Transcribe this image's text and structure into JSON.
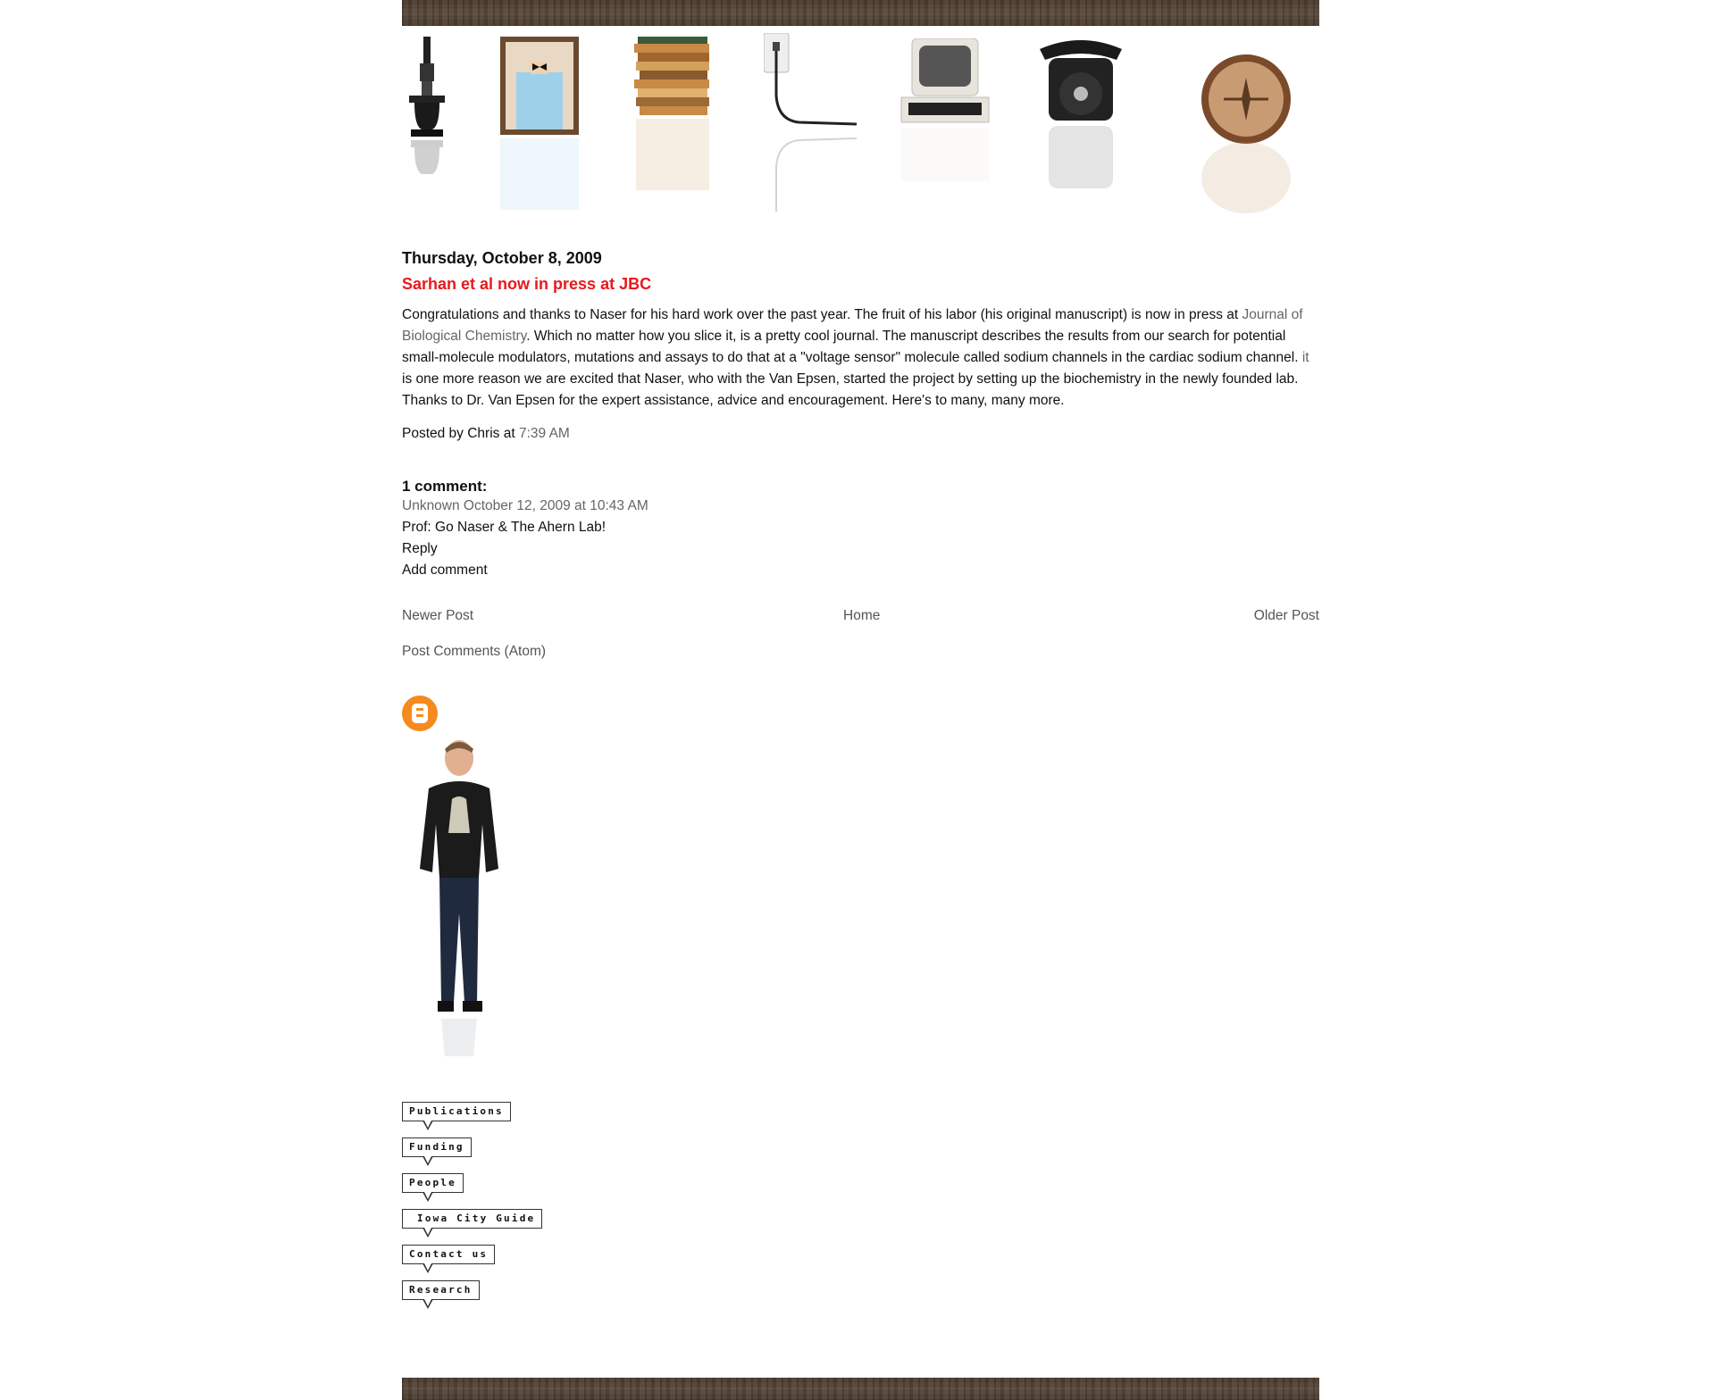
{
  "post": {
    "date": "Thursday, October 8, 2009",
    "title": "Sarhan et al now in press at JBC",
    "body_part1": "Congratulations and thanks to Naser for his hard work over the past year. The fruit of his labor (his original manuscript) is now in press at ",
    "journal_link": "Journal of Biological Chemistry",
    "body_part2": ". Which no matter how you slice it, is a pretty cool journal. The manuscript describes the results from our search for potential small-molecule modulators, mutations and assays to do that at a \"voltage sensor\" molecule called sodium channels in the cardiac sodium channel. ",
    "it_link": "it",
    "body_part3": " is one more reason we are excited that Naser, who with the Van Epsen, started the project by setting up the biochemistry in the newly founded lab. Thanks to Dr. Van Epsen for the expert assistance, advice and encouragement. Here's to many, many more.",
    "byline_prefix": "Posted by Chris at ",
    "time": "7:39 AM"
  },
  "comments": {
    "heading": "1 comment:",
    "items": [
      {
        "meta": "Unknown October 12, 2009 at 10:43 AM",
        "text": "Prof: Go Naser & The Ahern Lab!",
        "reply": "Reply"
      }
    ],
    "add": "Add comment"
  },
  "nav": {
    "newer": "Newer Post",
    "home": "Home",
    "older": "Older Post",
    "atom": "Post Comments (Atom)"
  },
  "menu": [
    "Publications",
    "Funding",
    "People",
    "Iowa City Guide",
    "Contact us",
    "Research"
  ],
  "header_objects": [
    "microscope",
    "framed-portrait",
    "book-stack",
    "power-cord",
    "vintage-computer",
    "rotary-phone",
    "compass"
  ],
  "colors": {
    "title": "#e8191b",
    "link": "#666666",
    "blogger": "#f58b1e"
  }
}
